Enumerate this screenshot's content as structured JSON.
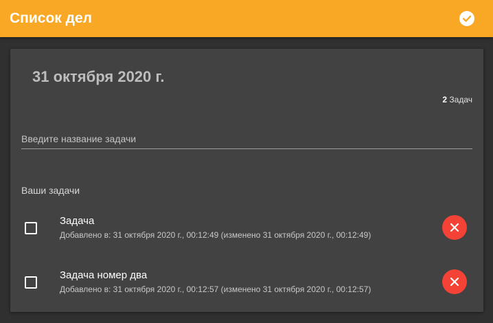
{
  "appbar": {
    "title": "Список дел",
    "check_icon": "check-circle-icon",
    "accent_color": "#F9A825"
  },
  "main": {
    "date_heading": "31 октября 2020 г.",
    "task_count": {
      "number": "2",
      "label": "Задач"
    },
    "input": {
      "placeholder": "Введите название задачи",
      "value": ""
    },
    "section_label": "Ваши задачи",
    "tasks": [
      {
        "title": "Задача",
        "meta": "Добавлено в: 31 октября 2020 г., 00:12:49 (изменено 31 октября 2020 г., 00:12:49)",
        "checked": false,
        "delete_icon": "close-icon"
      },
      {
        "title": "Задача номер два",
        "meta": "Добавлено в: 31 октября 2020 г., 00:12:57 (изменено 31 октября 2020 г., 00:12:57)",
        "checked": false,
        "delete_icon": "close-icon"
      }
    ],
    "delete_color": "#F44336",
    "card_color": "#424242"
  }
}
